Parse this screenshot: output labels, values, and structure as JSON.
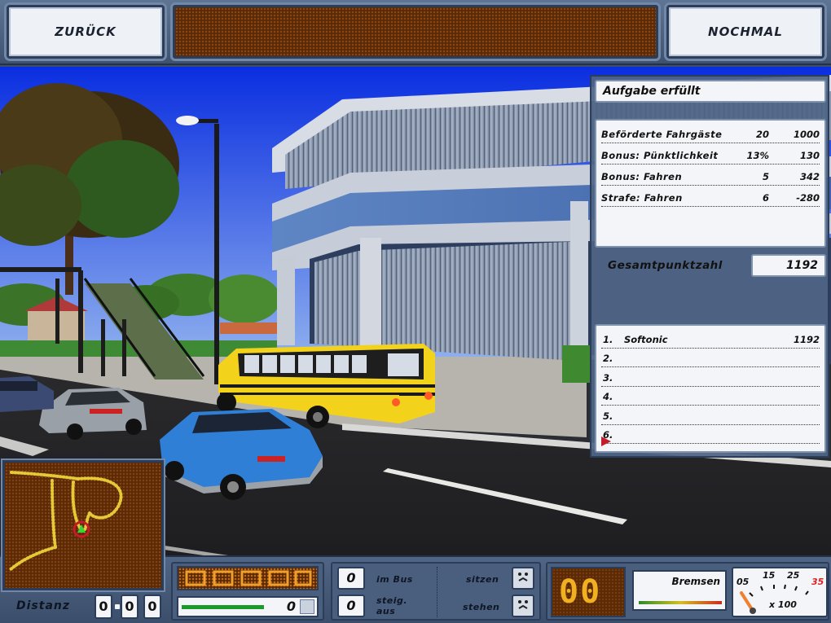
{
  "top_bar": {
    "back_label": "ZURÜCK",
    "retry_label": "NOCHMAL"
  },
  "result": {
    "title": "Aufgabe erfüllt",
    "rows": [
      {
        "label": "Beförderte Fahrgäste",
        "count": "20",
        "points": "1000"
      },
      {
        "label": "Bonus: Pünktlichkeit",
        "count": "13%",
        "points": "130"
      },
      {
        "label": "Bonus: Fahren",
        "count": "5",
        "points": "342"
      },
      {
        "label": "Strafe: Fahren",
        "count": "6",
        "points": "-280"
      }
    ],
    "total_label": "Gesamtpunktzahl",
    "total_value": "1192"
  },
  "ranking": [
    {
      "rank": "1.",
      "name": "Softonic",
      "score": "1192"
    },
    {
      "rank": "2.",
      "name": "",
      "score": ""
    },
    {
      "rank": "3.",
      "name": "",
      "score": ""
    },
    {
      "rank": "4.",
      "name": "",
      "score": ""
    },
    {
      "rank": "5.",
      "name": "",
      "score": ""
    },
    {
      "rank": "6.",
      "name": "",
      "score": ""
    }
  ],
  "hud": {
    "distance_label": "Distanz",
    "distance_digits": [
      "0",
      "0",
      "0"
    ],
    "speed_value": "0",
    "speed_fraction": 0.78,
    "in_bus_value": "0",
    "in_bus_label": "im Bus",
    "boarding_value": "0",
    "boarding_label_1": "steig.",
    "boarding_label_2": "aus",
    "seated_label": "sitzen",
    "standing_label": "stehen",
    "gear_display": "00",
    "brake_label": "Bremsen",
    "tacho_ticks": [
      "05",
      "15",
      "25",
      "35"
    ],
    "tacho_unit": "x 100"
  },
  "icons": {
    "passenger_seated": "passenger-face-icon",
    "passenger_standing": "passenger-face-icon",
    "map_marker": "bus-position-icon",
    "rank_cursor": "red-triangle-cursor-icon"
  },
  "colors": {
    "panel_blue": "#506586",
    "led_dark": "#5a2a08",
    "led_amber": "#f0b020",
    "bus_yellow": "#f2d21a",
    "car_blue": "#2f7fd6",
    "route_yellow": "#e6c936",
    "speed_green": "#1a9a2a"
  }
}
